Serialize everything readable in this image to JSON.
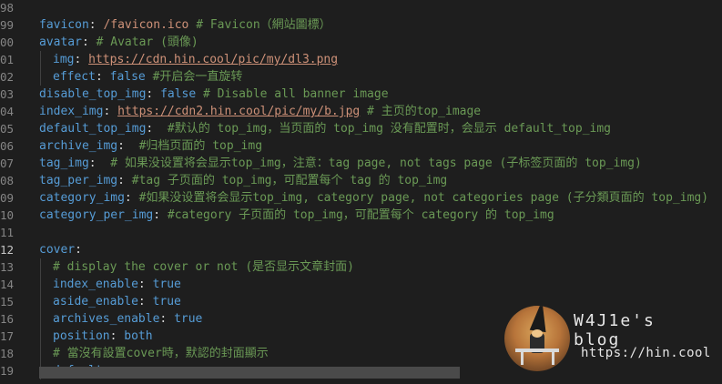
{
  "lines": [
    {
      "n": "98",
      "segs": []
    },
    {
      "n": "99",
      "segs": [
        [
          "k",
          "favicon"
        ],
        [
          "p",
          ": "
        ],
        [
          "s",
          "/favicon.ico "
        ],
        [
          "c",
          "# Favicon（網站圖標）"
        ]
      ]
    },
    {
      "n": "00",
      "segs": [
        [
          "k",
          "avatar"
        ],
        [
          "p",
          ": "
        ],
        [
          "c",
          "# Avatar (頭像)"
        ]
      ]
    },
    {
      "n": "01",
      "indent": 1,
      "segs": [
        [
          "k",
          "img"
        ],
        [
          "p",
          ": "
        ],
        [
          "url",
          "https://cdn.hin.cool/pic/my/dl3.png"
        ]
      ]
    },
    {
      "n": "02",
      "indent": 1,
      "segs": [
        [
          "k",
          "effect"
        ],
        [
          "p",
          ": "
        ],
        [
          "v",
          "false "
        ],
        [
          "c",
          "#开启会一直旋转"
        ]
      ]
    },
    {
      "n": "03",
      "segs": [
        [
          "k",
          "disable_top_img"
        ],
        [
          "p",
          ": "
        ],
        [
          "v",
          "false "
        ],
        [
          "c",
          "# Disable all banner image"
        ]
      ]
    },
    {
      "n": "04",
      "segs": [
        [
          "k",
          "index_img"
        ],
        [
          "p",
          ": "
        ],
        [
          "url",
          "https://cdn2.hin.cool/pic/my/b.jpg"
        ],
        [
          "c",
          " # 主页的top_image"
        ]
      ]
    },
    {
      "n": "05",
      "segs": [
        [
          "k",
          "default_top_img"
        ],
        [
          "p",
          ":  "
        ],
        [
          "c",
          "#默认的 top_img，当页面的 top_img 没有配置时，会显示 default_top_img"
        ]
      ]
    },
    {
      "n": "06",
      "segs": [
        [
          "k",
          "archive_img"
        ],
        [
          "p",
          ":  "
        ],
        [
          "c",
          "#归档页面的 top_img"
        ]
      ]
    },
    {
      "n": "07",
      "segs": [
        [
          "k",
          "tag_img"
        ],
        [
          "p",
          ":  "
        ],
        [
          "c",
          "# 如果没设置将会显示top_img，注意：tag page, not tags page (子标签页面的 top_img)"
        ]
      ]
    },
    {
      "n": "08",
      "segs": [
        [
          "k",
          "tag_per_img"
        ],
        [
          "p",
          ": "
        ],
        [
          "c",
          "#tag 子页面的 top_img，可配置每个 tag 的 top_img"
        ]
      ]
    },
    {
      "n": "09",
      "segs": [
        [
          "k",
          "category_img"
        ],
        [
          "p",
          ": "
        ],
        [
          "c",
          "#如果没设置将会显示top_img, category page, not categories page (子分類頁面的 top_img)"
        ]
      ]
    },
    {
      "n": "10",
      "segs": [
        [
          "k",
          "category_per_img"
        ],
        [
          "p",
          ": "
        ],
        [
          "c",
          "#category 子页面的 top_img，可配置每个 category 的 top_img"
        ]
      ]
    },
    {
      "n": "11",
      "segs": []
    },
    {
      "n": "12",
      "active": true,
      "segs": [
        [
          "k",
          "cover"
        ],
        [
          "p",
          ":"
        ]
      ]
    },
    {
      "n": "13",
      "indent": 1,
      "segs": [
        [
          "c",
          "# display the cover or not (是否显示文章封面)"
        ]
      ]
    },
    {
      "n": "14",
      "indent": 1,
      "segs": [
        [
          "k",
          "index_enable"
        ],
        [
          "p",
          ": "
        ],
        [
          "v",
          "true"
        ]
      ]
    },
    {
      "n": "15",
      "indent": 1,
      "segs": [
        [
          "k",
          "aside_enable"
        ],
        [
          "p",
          ": "
        ],
        [
          "v",
          "true"
        ]
      ]
    },
    {
      "n": "16",
      "indent": 1,
      "segs": [
        [
          "k",
          "archives_enable"
        ],
        [
          "p",
          ": "
        ],
        [
          "v",
          "true"
        ]
      ]
    },
    {
      "n": "17",
      "indent": 1,
      "segs": [
        [
          "k",
          "position"
        ],
        [
          "p",
          ": "
        ],
        [
          "v",
          "both"
        ]
      ]
    },
    {
      "n": "18",
      "indent": 1,
      "segs": [
        [
          "c",
          "# 當沒有設置cover時，默認的封面顯示"
        ]
      ]
    },
    {
      "n": "19",
      "indent": 1,
      "segs": [
        [
          "k",
          "default_cover"
        ],
        [
          "p",
          ":"
        ]
      ]
    }
  ],
  "watermark": {
    "title": "W4J1e's blog",
    "url": "https://hin.cool"
  },
  "colors": {
    "background": "#1e1e1e",
    "key": "#569cd6",
    "string": "#ce9178",
    "comment": "#6a9955",
    "line_number": "#858585"
  }
}
